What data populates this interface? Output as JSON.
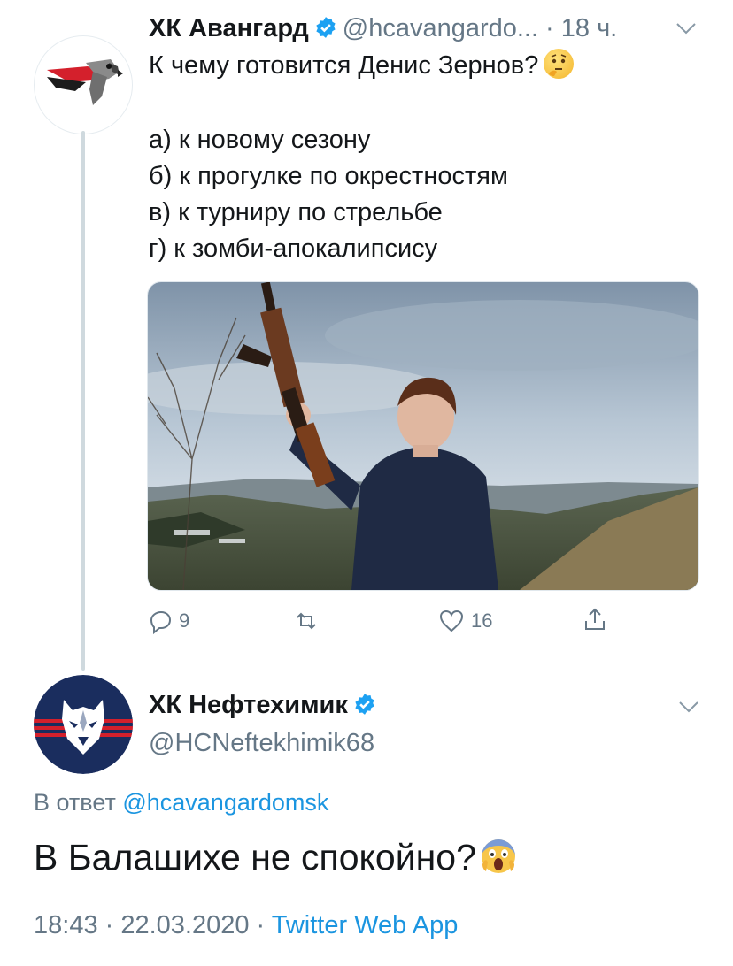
{
  "tweet1": {
    "author_name": "ХК Авангард",
    "handle": "@hcavangardo...",
    "time": "· 18 ч.",
    "text": "К чему готовится Денис Зернов?",
    "options": [
      "а) к новому сезону",
      "б) к прогулке по окрестностям",
      "в) к турниру по стрельбе",
      "г) к зомби-апокалипсису"
    ],
    "emoji": "thinking-face",
    "replies": "9",
    "retweets": "",
    "likes": "16"
  },
  "tweet2": {
    "author_name": "ХК Нефтехимик",
    "handle": "@HCNeftekhimik68",
    "reply_prefix": "В ответ",
    "reply_handle": "@hcavangardomsk",
    "text": "В Балашихе не спокойно?",
    "emoji": "screaming-face",
    "time": "18:43 · 22.03.2020 ·",
    "source": "Twitter Web App"
  },
  "colors": {
    "verified": "#1da1f2",
    "link": "#1b95e0",
    "secondary": "#657786",
    "accent_red": "#d4202c",
    "navy": "#1a2d5e"
  }
}
